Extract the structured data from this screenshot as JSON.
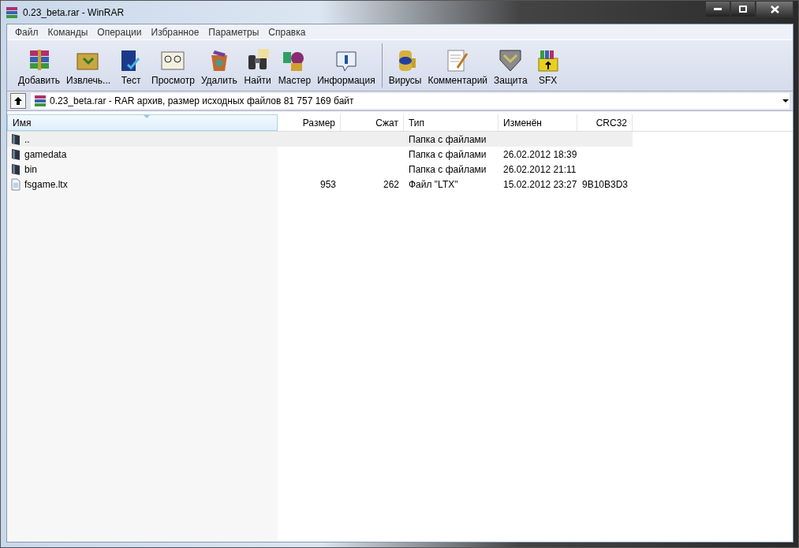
{
  "window": {
    "title": "0.23_beta.rar - WinRAR"
  },
  "menu": [
    "Файл",
    "Команды",
    "Операции",
    "Избранное",
    "Параметры",
    "Справка"
  ],
  "toolbar": [
    [
      "Добавить",
      "Извлечь...",
      "Тест",
      "Просмотр",
      "Удалить",
      "Найти",
      "Мастер",
      "Информация"
    ],
    [
      "Вирусы",
      "Комментарий",
      "Защита",
      "SFX"
    ]
  ],
  "address": {
    "value": "0.23_beta.rar - RAR архив, размер исходных файлов 81 757 169 байт"
  },
  "table": {
    "columns": [
      {
        "label": "Имя",
        "sorted": true
      },
      {
        "label": "Размер",
        "sorted": false
      },
      {
        "label": "Сжат",
        "sorted": false
      },
      {
        "label": "Тип",
        "sorted": false
      },
      {
        "label": "Изменён",
        "sorted": false
      },
      {
        "label": "CRC32",
        "sorted": false
      }
    ],
    "rows": [
      {
        "kind": "up",
        "selected": true,
        "cells": [
          "..",
          "",
          "",
          "Папка с файлами",
          "",
          ""
        ]
      },
      {
        "kind": "folder",
        "selected": false,
        "cells": [
          "gamedata",
          "",
          "",
          "Папка с файлами",
          "26.02.2012 18:39",
          ""
        ]
      },
      {
        "kind": "folder",
        "selected": false,
        "cells": [
          "bin",
          "",
          "",
          "Папка с файлами",
          "26.02.2012 21:11",
          ""
        ]
      },
      {
        "kind": "file",
        "selected": false,
        "cells": [
          "fsgame.ltx",
          "953",
          "262",
          "Файл \"LTX\"",
          "15.02.2012 23:27",
          "9B10B3D3"
        ]
      }
    ]
  }
}
